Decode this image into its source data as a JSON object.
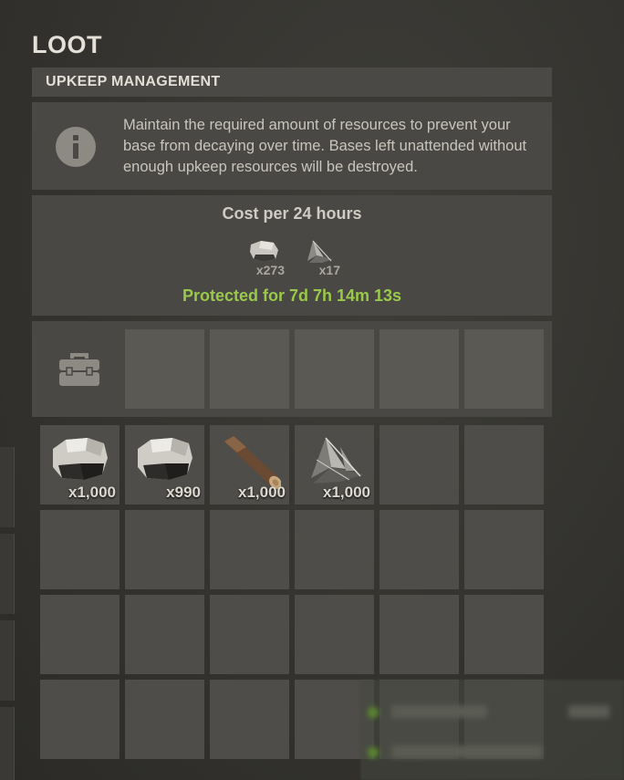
{
  "loot_title": "LOOT",
  "upkeep": {
    "header": "UPKEEP MANAGEMENT",
    "info_icon": "info-icon",
    "info_text": "Maintain the required amount of resources to prevent your base from decaying over time. Bases left unattended without enough upkeep resources will be destroyed."
  },
  "cost": {
    "title": "Cost per 24 hours",
    "items": [
      {
        "icon": "stone-icon",
        "qty": "x273"
      },
      {
        "icon": "metal-fragments-icon",
        "qty": "x17"
      }
    ],
    "protected_text": "Protected for 7d 7h 14m 13s",
    "protected_color": "#9ac84b"
  },
  "toolbox": {
    "icon": "toolbox-icon"
  },
  "inventory": {
    "items": [
      {
        "icon": "stone-icon",
        "qty": "x1,000"
      },
      {
        "icon": "stone-icon",
        "qty": "x990"
      },
      {
        "icon": "wood-icon",
        "qty": "x1,000"
      },
      {
        "icon": "metal-fragments-icon",
        "qty": "x1,000"
      }
    ]
  }
}
